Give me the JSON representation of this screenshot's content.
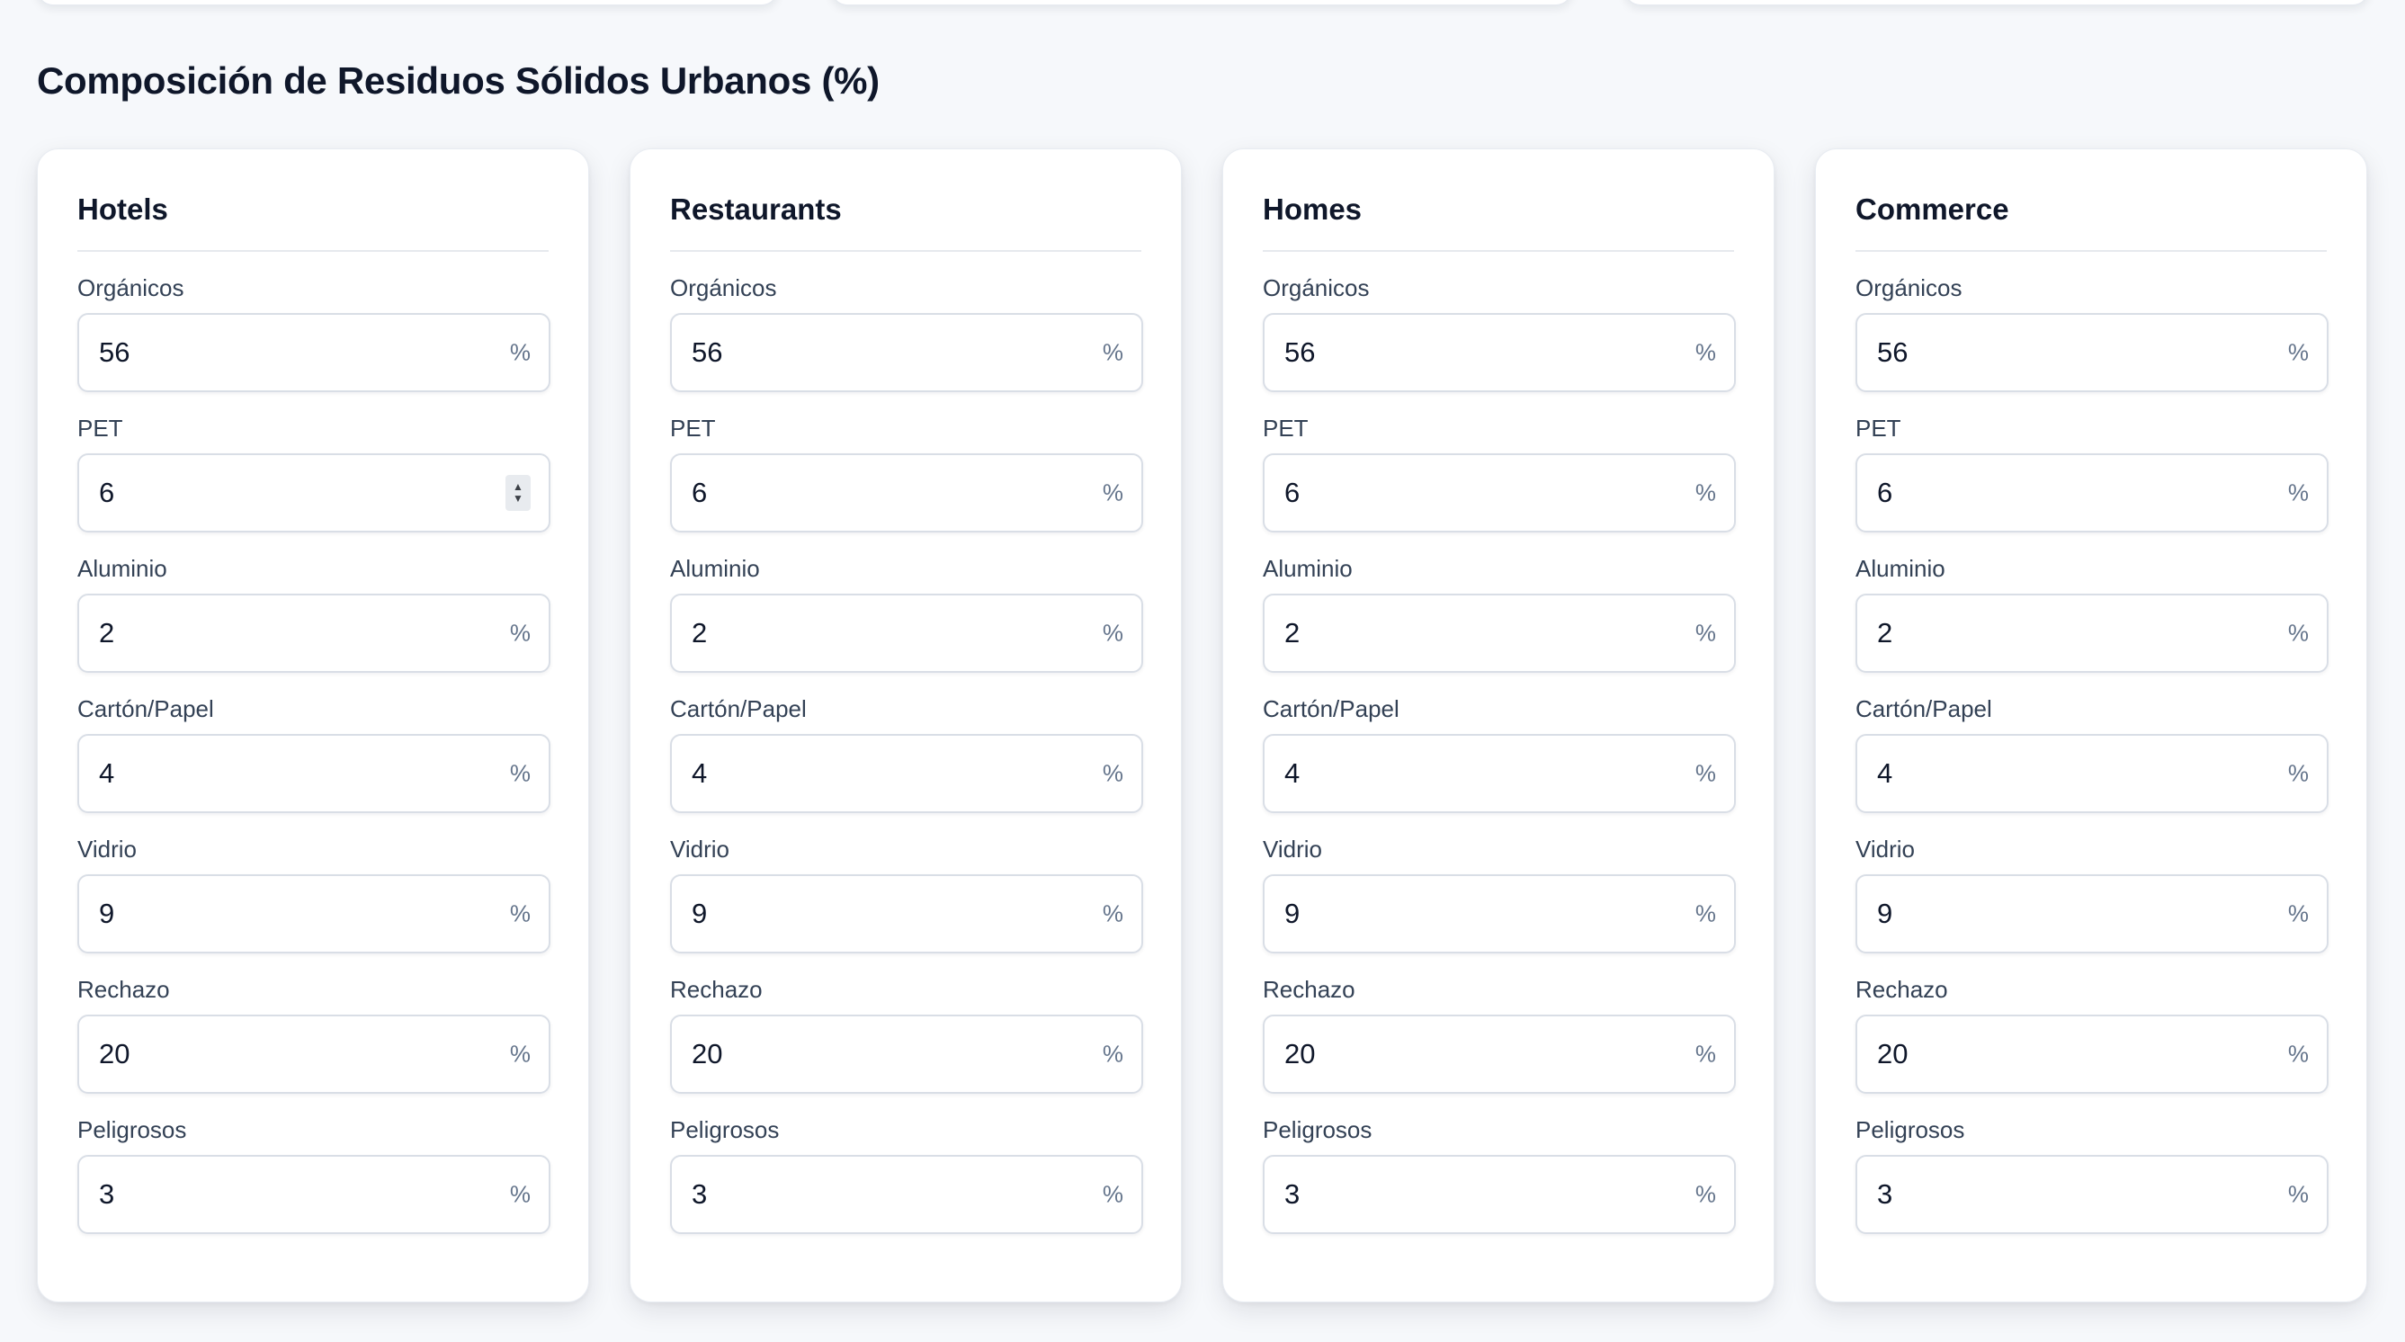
{
  "section": {
    "title": "Composición de Residuos Sólidos Urbanos (%)"
  },
  "unit": "%",
  "cards": [
    {
      "title": "Hotels",
      "fields": [
        {
          "label": "Orgánicos",
          "value": "56"
        },
        {
          "label": "PET",
          "value": "6"
        },
        {
          "label": "Aluminio",
          "value": "2"
        },
        {
          "label": "Cartón/Papel",
          "value": "4"
        },
        {
          "label": "Vidrio",
          "value": "9"
        },
        {
          "label": "Rechazo",
          "value": "20"
        },
        {
          "label": "Peligrosos",
          "value": "3"
        }
      ]
    },
    {
      "title": "Restaurants",
      "fields": [
        {
          "label": "Orgánicos",
          "value": "56"
        },
        {
          "label": "PET",
          "value": "6"
        },
        {
          "label": "Aluminio",
          "value": "2"
        },
        {
          "label": "Cartón/Papel",
          "value": "4"
        },
        {
          "label": "Vidrio",
          "value": "9"
        },
        {
          "label": "Rechazo",
          "value": "20"
        },
        {
          "label": "Peligrosos",
          "value": "3"
        }
      ]
    },
    {
      "title": "Homes",
      "fields": [
        {
          "label": "Orgánicos",
          "value": "56"
        },
        {
          "label": "PET",
          "value": "6"
        },
        {
          "label": "Aluminio",
          "value": "2"
        },
        {
          "label": "Cartón/Papel",
          "value": "4"
        },
        {
          "label": "Vidrio",
          "value": "9"
        },
        {
          "label": "Rechazo",
          "value": "20"
        },
        {
          "label": "Peligrosos",
          "value": "3"
        }
      ]
    },
    {
      "title": "Commerce",
      "fields": [
        {
          "label": "Orgánicos",
          "value": "56"
        },
        {
          "label": "PET",
          "value": "6"
        },
        {
          "label": "Aluminio",
          "value": "2"
        },
        {
          "label": "Cartón/Papel",
          "value": "4"
        },
        {
          "label": "Vidrio",
          "value": "9"
        },
        {
          "label": "Rechazo",
          "value": "20"
        },
        {
          "label": "Peligrosos",
          "value": "3"
        }
      ]
    }
  ],
  "focused_spinner": {
    "card": 0,
    "field": 1,
    "icon": "spinner-arrows-icon"
  }
}
